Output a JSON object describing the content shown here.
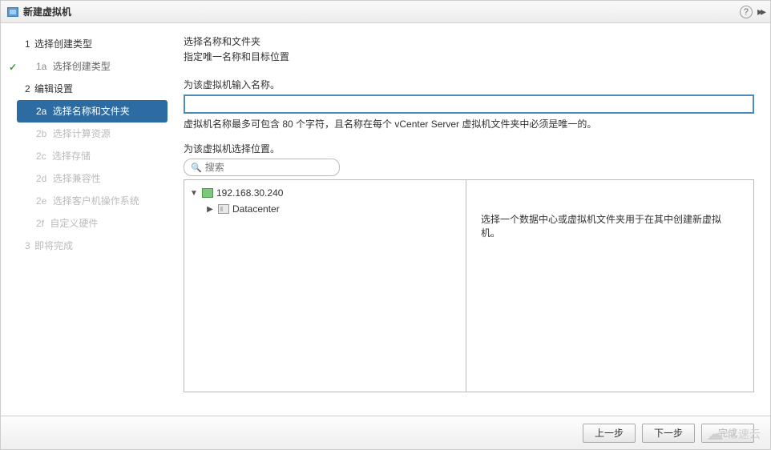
{
  "window": {
    "title": "新建虚拟机"
  },
  "sidebar": {
    "steps": [
      {
        "num": "1",
        "label": "选择创建类型"
      },
      {
        "num": "1a",
        "label": "选择创建类型"
      },
      {
        "num": "2",
        "label": "编辑设置"
      },
      {
        "num": "2a",
        "label": "选择名称和文件夹"
      },
      {
        "num": "2b",
        "label": "选择计算资源"
      },
      {
        "num": "2c",
        "label": "选择存储"
      },
      {
        "num": "2d",
        "label": "选择兼容性"
      },
      {
        "num": "2e",
        "label": "选择客户机操作系统"
      },
      {
        "num": "2f",
        "label": "自定义硬件"
      },
      {
        "num": "3",
        "label": "即将完成"
      }
    ]
  },
  "main": {
    "heading": "选择名称和文件夹",
    "subheading": "指定唯一名称和目标位置",
    "name_label": "为该虚拟机输入名称。",
    "name_value": "",
    "name_hint": "虚拟机名称最多可包含 80 个字符，且名称在每个 vCenter Server 虚拟机文件夹中必须是唯一的。",
    "location_label": "为该虚拟机选择位置。",
    "search_placeholder": "搜索",
    "tree": {
      "server": "192.168.30.240",
      "datacenter": "Datacenter"
    },
    "desc": "选择一个数据中心或虚拟机文件夹用于在其中创建新虚拟机。"
  },
  "footer": {
    "back": "上一步",
    "next": "下一步",
    "finish": "完成"
  },
  "watermark": "亿速云"
}
